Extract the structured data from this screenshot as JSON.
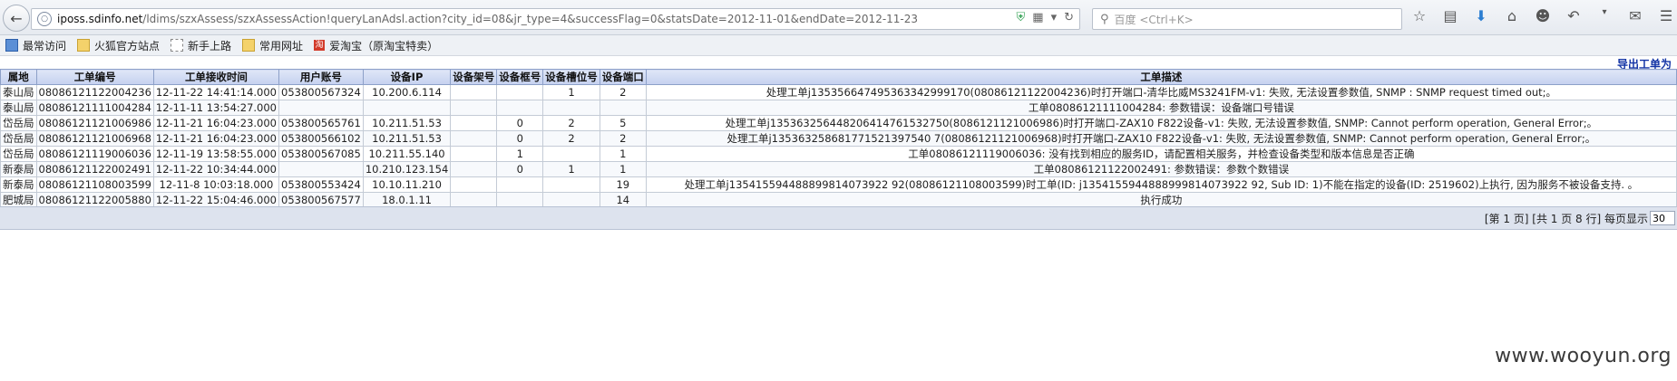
{
  "browser": {
    "url_host": "iposs.sdinfo.net",
    "url_path": "/ldims/szxAssess/szxAssessAction!queryLanAdsl.action?city_id=08&jr_type=4&successFlag=0&statsDate=2012-11-01&endDate=2012-11-23",
    "search_placeholder": "百度 <Ctrl+K>",
    "icons": [
      "back-icon",
      "globe-icon",
      "shield-icon",
      "qr-icon",
      "dropdown-icon",
      "reload-icon",
      "search-icon",
      "star-icon",
      "library-icon",
      "download-icon",
      "home-icon",
      "smile-icon",
      "undo-icon",
      "chat-icon",
      "menu-icon"
    ]
  },
  "bookmarks": [
    {
      "label": "最常访问",
      "icon": "blue"
    },
    {
      "label": "火狐官方站点",
      "icon": "folder"
    },
    {
      "label": "新手上路",
      "icon": "dash"
    },
    {
      "label": "常用网址",
      "icon": "folder"
    },
    {
      "label": "爱淘宝（原淘宝特卖）",
      "icon": "red"
    }
  ],
  "page": {
    "export_link": "导出工单为",
    "columns": [
      "属地",
      "工单编号",
      "工单接收时间",
      "用户账号",
      "设备IP",
      "设备架号",
      "设备框号",
      "设备槽位号",
      "设备端口",
      "工单描述"
    ],
    "rows": [
      [
        "泰山局",
        "08086121122004236",
        "12-11-22 14:41:14.000",
        "053800567324",
        "10.200.6.114",
        "",
        "",
        "1",
        "2",
        "处理工单j135356647495363342999170(08086121122004236)时打开端口-清华比威MS3241FM-v1: 失败, 无法设置参数值, SNMP : SNMP request timed out;。"
      ],
      [
        "泰山局",
        "08086121111004284",
        "12-11-11 13:54:27.000",
        "",
        "",
        "",
        "",
        "",
        "",
        "工单08086121111004284: 参数错误：设备端口号错误"
      ],
      [
        "岱岳局",
        "08086121121006986",
        "12-11-21 16:04:23.000",
        "053800565761",
        "10.211.51.53",
        "",
        "0",
        "2",
        "5",
        "处理工单j135363256448206414761532750(8086121121006986)时打开端口-ZAX10 F822设备-v1: 失败, 无法设置参数值, SNMP: Cannot perform operation, General Error;。"
      ],
      [
        "岱岳局",
        "08086121121006968",
        "12-11-21 16:04:23.000",
        "053800566102",
        "10.211.51.53",
        "",
        "0",
        "2",
        "2",
        "处理工单j135363258681771521397540 7(08086121121006968)时打开端口-ZAX10 F822设备-v1: 失败, 无法设置参数值, SNMP: Cannot perform operation, General Error;。"
      ],
      [
        "岱岳局",
        "08086121119006036",
        "12-11-19 13:58:55.000",
        "053800567085",
        "10.211.55.140",
        "",
        "1",
        "",
        "1",
        "工单08086121119006036: 没有找到相应的服务ID，请配置相关服务，并检查设备类型和版本信息是否正确"
      ],
      [
        "新泰局",
        "08086121122002491",
        "12-11-22 10:34:44.000",
        "",
        "10.210.123.154",
        "",
        "0",
        "1",
        "1",
        "工单08086121122002491: 参数错误：参数个数错误"
      ],
      [
        "新泰局",
        "08086121108003599",
        "12-11-8 10:03:18.000",
        "053800553424",
        "10.10.11.210",
        "",
        "",
        "",
        "19",
        "处理工单j135415594488899814073922 92(08086121108003599)时工单(ID: j1354155944888999814073922 92, Sub ID: 1)不能在指定的设备(ID: 2519602)上执行, 因为服务不被设备支持. 。"
      ],
      [
        "肥城局",
        "08086121122005880",
        "12-11-22 15:04:46.000",
        "053800567577",
        "18.0.1.11",
        "",
        "",
        "",
        "14",
        "执行成功"
      ]
    ],
    "pager_text": "[第 1 页] [共 1 页 8 行] 每页显示",
    "page_size": "30"
  },
  "watermark": "www.wooyun.org"
}
